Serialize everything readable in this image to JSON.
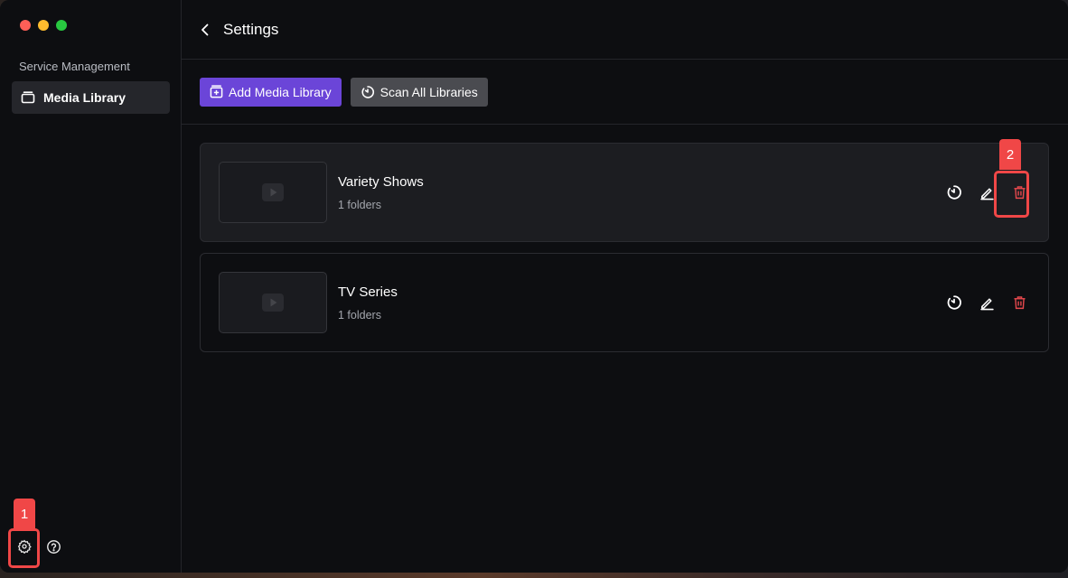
{
  "window": {
    "traffic_lights": [
      "close",
      "minimize",
      "zoom"
    ]
  },
  "sidebar": {
    "section_title": "Service Management",
    "items": [
      {
        "label": "Media Library",
        "icon": "library-icon",
        "active": true
      }
    ],
    "bottom": {
      "settings_icon": "gear-icon",
      "help_icon": "help-circle-icon"
    }
  },
  "header": {
    "title": "Settings",
    "back_icon": "chevron-left-icon"
  },
  "toolbar": {
    "add_label": "Add Media Library",
    "scan_label": "Scan All Libraries"
  },
  "libraries": [
    {
      "name": "Variety Shows",
      "folders": "1 folders"
    },
    {
      "name": "TV Series",
      "folders": "1 folders"
    }
  ],
  "annotations": {
    "first": "1",
    "second": "2"
  },
  "colors": {
    "accent": "#6b45d8",
    "secondary_button": "#4a4b50",
    "delete": "#e5484d",
    "annotation": "#f04747"
  }
}
